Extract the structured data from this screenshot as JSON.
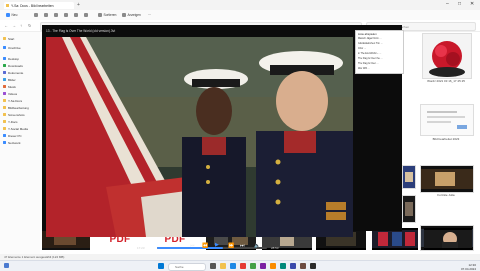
{
  "window": {
    "tab_title": "Y-Sa: Docs - Bild bearbeiten",
    "new_tab": "+",
    "minimize": "–",
    "maximize": "□",
    "close": "✕"
  },
  "commandbar": {
    "new_label": "Neu",
    "sort_label": "Sortieren",
    "view_label": "Anzeigen",
    "more_label": "···"
  },
  "navbar": {
    "address": "« Y-Sa: Docs › Bild bearbeiten",
    "search_placeholder": "Bild bearbeiten durchsuchen"
  },
  "sidebar": {
    "items": [
      {
        "label": "Start",
        "color": "#f2c14e"
      },
      {
        "label": "OneDrive",
        "color": "#3b8cff"
      },
      {
        "label": "Desktop",
        "color": "#3b8cff"
      },
      {
        "label": "Downloads",
        "color": "#2aa84a"
      },
      {
        "label": "Dokumente",
        "color": "#5a6bd4"
      },
      {
        "label": "Bilder",
        "color": "#3ba0e6"
      },
      {
        "label": "Musik",
        "color": "#e06b3b"
      },
      {
        "label": "Videos",
        "color": "#9b4fd4"
      },
      {
        "label": "Y-Sa Docs",
        "color": "#f2c14e"
      },
      {
        "label": "Bildbearbeitung",
        "color": "#f2c14e"
      },
      {
        "label": "Screenshots",
        "color": "#f2c14e"
      },
      {
        "label": "Y-Docs",
        "color": "#f2c14e"
      },
      {
        "label": "Y-Social Media",
        "color": "#f2c14e"
      },
      {
        "label": "Dieser PC",
        "color": "#3b8cff"
      },
      {
        "label": "Netzwerk",
        "color": "#3b8cff"
      }
    ]
  },
  "player": {
    "title": "13 - The Flag Is Over The World (old version).3vt",
    "time_current": "17:23",
    "time_total": "28:53",
    "progress": 0.6,
    "play_icon": "play-icon"
  },
  "sidepanel": {
    "header": "Liste abspielen",
    "rows": [
      "Marsch Jäger/Vorm …",
      "Glückstäubchen Trm …",
      "Chor …",
      "in The End World – …",
      "The Flag Is Over the …",
      "The Flag Is Over …",
      "Wer Will …"
    ]
  },
  "right_pane": {
    "captions": [
      "Wordz 2021 03 16_17 45 25",
      "Bild bearbeitet 2023",
      "Fortnite Julia"
    ]
  },
  "strip": {
    "pdf_label_1": "PDF",
    "pdf_label_2": "PDF"
  },
  "status": {
    "text": "47 Elemente   1 Element ausgewählt (124 MB)"
  },
  "taskbar": {
    "search_placeholder": "Suche",
    "time": "12:30",
    "date": "07.04.2024"
  }
}
